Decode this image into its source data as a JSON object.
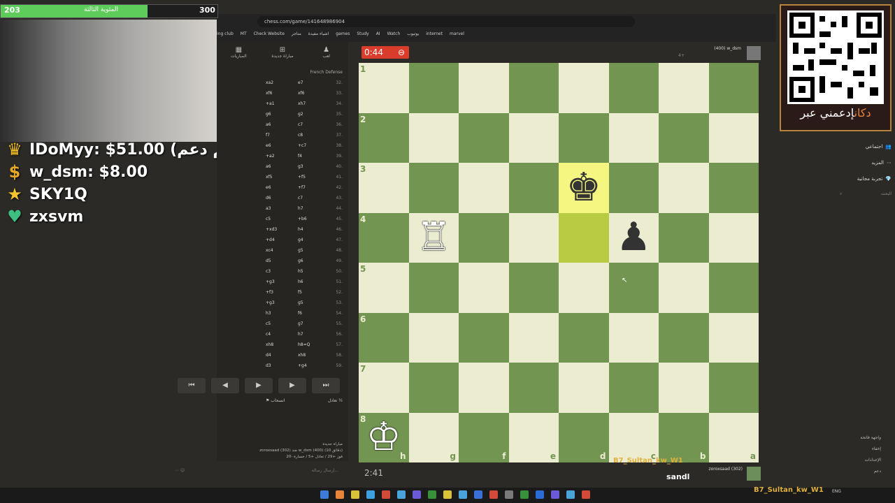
{
  "browser": {
    "url": "chess.com/game/141648986904",
    "bookmarks": [
      "ing club",
      "MT",
      "Check Website",
      "متاجر",
      "اشياء مفيدة",
      "games",
      "Study",
      "AI",
      "Watch",
      "يوتيوب",
      "internet",
      "marvel"
    ]
  },
  "move_panel": {
    "tabs": [
      {
        "label": "المباريات",
        "icon": "▦"
      },
      {
        "label": "مباراة جديدة",
        "icon": "⊞"
      },
      {
        "label": "لعب",
        "icon": "♟"
      }
    ],
    "opening": "French Defense",
    "moves": [
      {
        "n": "32.",
        "w": "e7",
        "b": "xa2"
      },
      {
        "n": "33.",
        "w": "xf6",
        "b": "xf6"
      },
      {
        "n": "34.",
        "w": "xh7",
        "b": "+a1"
      },
      {
        "n": "35.",
        "w": "g2",
        "b": "g6"
      },
      {
        "n": "36.",
        "w": "c7",
        "b": "a6"
      },
      {
        "n": "37.",
        "w": "c8",
        "b": "f7"
      },
      {
        "n": "38.",
        "w": "+c7",
        "b": "e6"
      },
      {
        "n": "39.",
        "w": "f4",
        "b": "+a2"
      },
      {
        "n": "40.",
        "w": "g3",
        "b": "a6"
      },
      {
        "n": "41.",
        "w": "+f5",
        "b": "xf5"
      },
      {
        "n": "42.",
        "w": "+f7",
        "b": "e6"
      },
      {
        "n": "43.",
        "w": "c7",
        "b": "d6"
      },
      {
        "n": "44.",
        "w": "h7",
        "b": "a3"
      },
      {
        "n": "45.",
        "w": "+b6",
        "b": "c5"
      },
      {
        "n": "46.",
        "w": "h4",
        "b": "+xd3"
      },
      {
        "n": "47.",
        "w": "g4",
        "b": "+d4"
      },
      {
        "n": "48.",
        "w": "g5",
        "b": "xc4"
      },
      {
        "n": "49.",
        "w": "g6",
        "b": "d5"
      },
      {
        "n": "50.",
        "w": "h5",
        "b": "c3"
      },
      {
        "n": "51.",
        "w": "h6",
        "b": "+g3"
      },
      {
        "n": "52.",
        "w": "f5",
        "b": "+f3"
      },
      {
        "n": "53.",
        "w": "g5",
        "b": "+g3"
      },
      {
        "n": "54.",
        "w": "f6",
        "b": "h3"
      },
      {
        "n": "55.",
        "w": "g7",
        "b": "c5"
      },
      {
        "n": "56.",
        "w": "h7",
        "b": "c4"
      },
      {
        "n": "57.",
        "w": "h8=Q",
        "b": "xh8"
      },
      {
        "n": "58.",
        "w": "xh8",
        "b": "d4"
      },
      {
        "n": "59.",
        "w": "+g4",
        "b": "d3"
      }
    ],
    "nav": [
      "⏮",
      "◀",
      "▶",
      "▶",
      "⏭"
    ],
    "draw_label": "تعادل",
    "resign_label": "انسحاب",
    "game_info": [
      "مباراة جديدة",
      "zoroxsaad (302) ضد w_dsm (400) (10 دقائق)",
      "فوز +29 / تعادل +5 / خسارة -20"
    ],
    "chat_placeholder": "إرسال رسالة..."
  },
  "board": {
    "ranks": [
      "1",
      "2",
      "3",
      "4",
      "5",
      "6",
      "7",
      "8"
    ],
    "files": [
      "h",
      "g",
      "f",
      "e",
      "d",
      "c",
      "b",
      "a"
    ],
    "pieces": [
      {
        "square": [
          2,
          4
        ],
        "glyph": "♚",
        "side": "black",
        "name": "black-king"
      },
      {
        "square": [
          3,
          1
        ],
        "glyph": "♖",
        "side": "white",
        "name": "white-rook"
      },
      {
        "square": [
          3,
          5
        ],
        "glyph": "♟",
        "side": "black",
        "name": "black-pawn"
      },
      {
        "square": [
          7,
          0
        ],
        "glyph": "♔",
        "side": "white",
        "name": "white-king"
      }
    ],
    "highlights": [
      {
        "square": [
          2,
          4
        ],
        "color": "#f5f682"
      },
      {
        "square": [
          3,
          4
        ],
        "color": "#b9ca43"
      }
    ],
    "light_color": "#ebecd0",
    "dark_color": "#739552"
  },
  "players": {
    "top": {
      "name": "w_dsm",
      "rating": "(400)",
      "clock": "0:44"
    },
    "top_extra": "4+",
    "bottom": {
      "name": "zoroxsaad",
      "rating": "(302)",
      "clock": "2:41"
    }
  },
  "stream": {
    "goal_left": "203",
    "goal_right": "300",
    "goal_text": "المئوية الثالثة",
    "goal_fraction": 0.677,
    "donations": [
      {
        "icon": "♛",
        "text": "IDoMyy: $51.00 (أعظم دعم)",
        "color": "#f2c029"
      },
      {
        "icon": "$",
        "text": "w_dsm: $8.00",
        "color": "#e4a728"
      },
      {
        "icon": "★",
        "text": "SKY1Q",
        "color": "#f4c430"
      },
      {
        "icon": "♥",
        "text": "zxsvm",
        "color": "#3fbf7f"
      }
    ],
    "qr_text_a": "إدعمني عبر",
    "qr_text_b": "دكان",
    "overlay_1": "B7_Sultan_kw_W1",
    "overlay_2": "sandl",
    "overlay_3": "B7_Sultan_kw_W1"
  },
  "sidebar": {
    "items": [
      {
        "label": "اجتماعي",
        "icon": "👥"
      },
      {
        "label": "المزيد",
        "icon": "⋯"
      },
      {
        "label": "تجربة مجانية",
        "icon": "💎"
      }
    ],
    "search_placeholder": "البحث",
    "bottom": [
      "واجهة فاتحة",
      "إخفاء",
      "الإعدادات",
      "دعم"
    ]
  },
  "taskbar": {
    "lang": "ENG"
  }
}
